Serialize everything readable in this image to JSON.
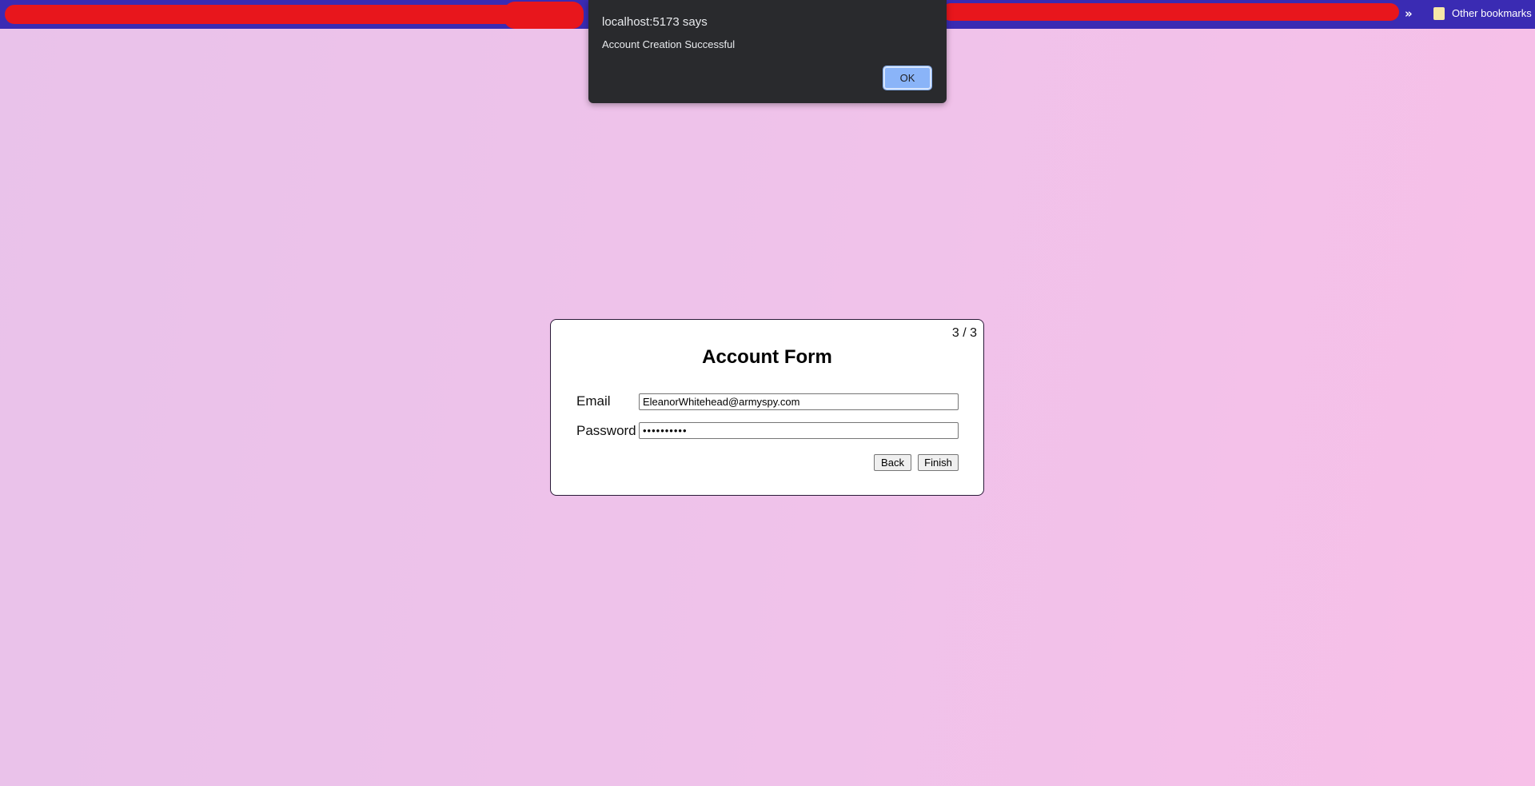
{
  "browser": {
    "bookmarks_bar": {
      "overflow_icon": "chevron-double-right",
      "overflow_glyph": "»",
      "other_bookmarks_label": "Other bookmarks",
      "folder_icon": "folder-icon",
      "bar_color": "#3a2bb3"
    }
  },
  "alert": {
    "title": "localhost:5173 says",
    "message": "Account Creation Successful",
    "ok_label": "OK",
    "ok_color": "#8ab4f8",
    "background_color": "#292a2d"
  },
  "form": {
    "step": "3 / 3",
    "title": "Account Form",
    "email_label": "Email",
    "email_value": "EleanorWhitehead@armyspy.com",
    "password_label": "Password",
    "password_value": "••••••••••",
    "back_label": "Back",
    "finish_label": "Finish"
  }
}
